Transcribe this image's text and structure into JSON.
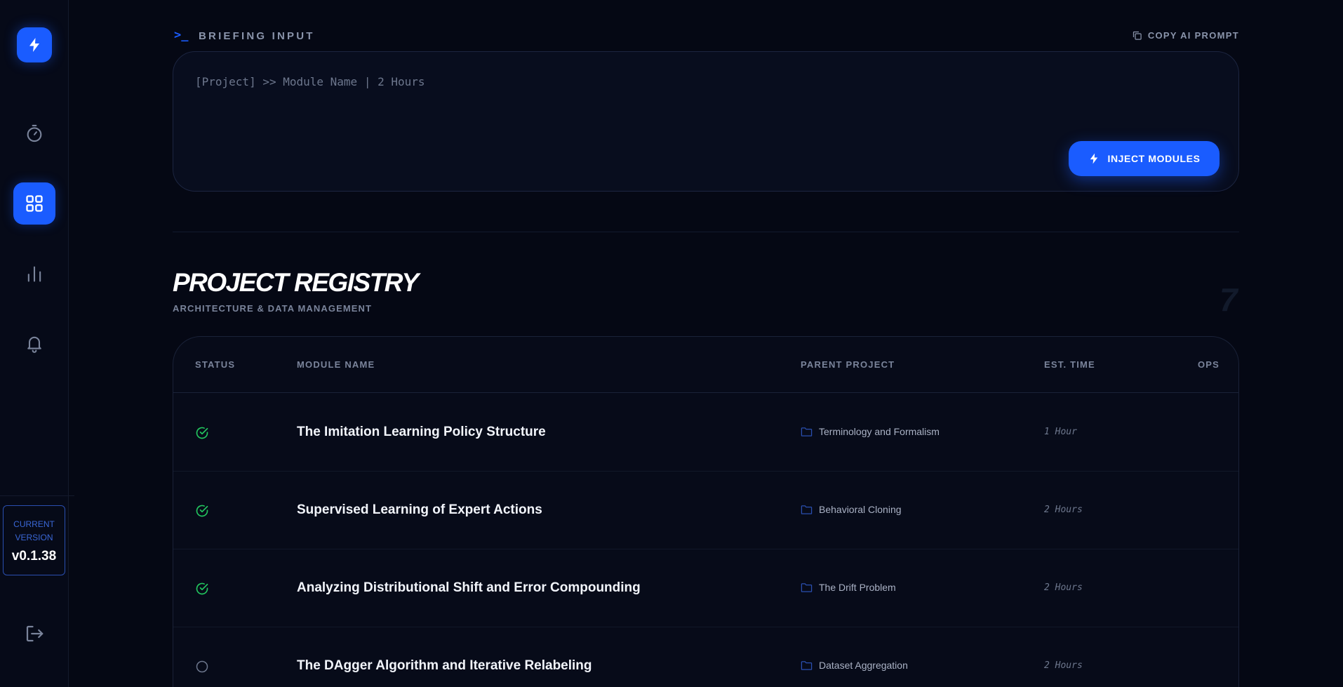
{
  "sidebar": {
    "version_label_line1": "CURRENT",
    "version_label_line2": "VERSION",
    "version_number": "v0.1.38",
    "icons": [
      "lightning-logo-icon",
      "timer-icon",
      "grid-icon",
      "bar-chart-icon",
      "bell-icon",
      "logout-icon"
    ],
    "active_item": "grid"
  },
  "briefing": {
    "title": "BRIEFING INPUT",
    "copy_label": "COPY AI PROMPT",
    "placeholder": "[Project] >> Module Name | 2 Hours",
    "inject_label": "INJECT MODULES"
  },
  "registry": {
    "title": "PROJECT REGISTRY",
    "subtitle": "ARCHITECTURE & DATA MANAGEMENT",
    "count": "7",
    "columns": {
      "status": "STATUS",
      "module": "MODULE NAME",
      "parent": "PARENT PROJECT",
      "est": "EST. TIME",
      "ops": "OPS"
    },
    "rows": [
      {
        "status": "complete",
        "module": "The Imitation Learning Policy Structure",
        "parent": "Terminology and Formalism",
        "est": "1 Hour"
      },
      {
        "status": "complete",
        "module": "Supervised Learning of Expert Actions",
        "parent": "Behavioral Cloning",
        "est": "2 Hours"
      },
      {
        "status": "complete",
        "module": "Analyzing Distributional Shift and Error Compounding",
        "parent": "The Drift Problem",
        "est": "2 Hours"
      },
      {
        "status": "pending",
        "module": "The DAgger Algorithm and Iterative Relabeling",
        "parent": "Dataset Aggregation",
        "est": "2 Hours"
      }
    ]
  },
  "colors": {
    "accent": "#1a5cff",
    "complete": "#22c55e",
    "pending": "#6d778d",
    "background": "#050814"
  }
}
